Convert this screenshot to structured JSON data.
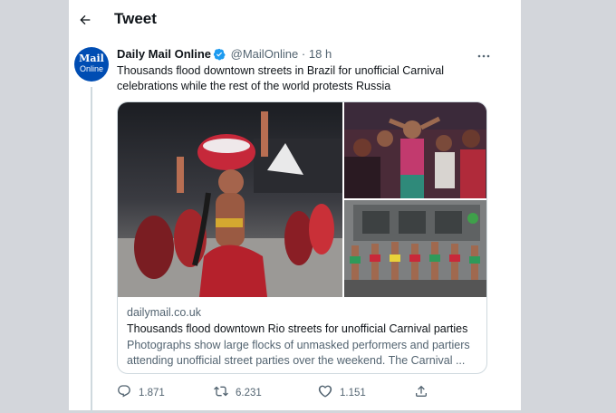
{
  "header": {
    "title": "Tweet"
  },
  "avatar": {
    "line1": "Mail",
    "line2": "Online"
  },
  "tweet": {
    "name": "Daily Mail Online",
    "handle": "@MailOnline",
    "separator": "·",
    "time": "18 h",
    "text": "Thousands flood downtown streets in Brazil for unofficial Carnival celebrations while the rest of the world protests Russia"
  },
  "card": {
    "domain": "dailymail.co.uk",
    "title": "Thousands flood downtown Rio streets for unofficial Carnival parties",
    "description": "Photographs show large flocks of unmasked performers and partiers attending unofficial street parties over the weekend. The Carnival ..."
  },
  "actions": {
    "replies": "1.871",
    "retweets": "6.231",
    "likes": "1.151"
  },
  "colors": {
    "verified": "#1d9bf0",
    "avatar": "#004db3",
    "muted": "#536471"
  },
  "icons": [
    "back-arrow-icon",
    "verified-badge-icon",
    "more-options-icon",
    "reply-icon",
    "retweet-icon",
    "like-icon",
    "share-icon"
  ]
}
